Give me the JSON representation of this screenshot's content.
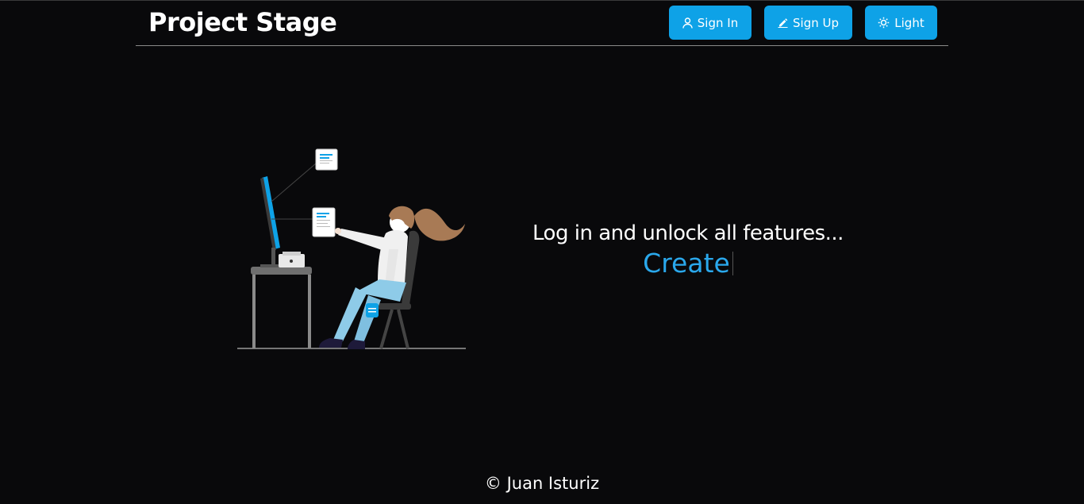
{
  "header": {
    "brand": "Project Stage",
    "buttons": {
      "sign_in": "Sign In",
      "sign_up": "Sign Up",
      "theme": "Light"
    }
  },
  "main": {
    "headline": "Log in and unlock all features...",
    "link": "Create"
  },
  "footer": {
    "copyright": "© Juan Isturiz"
  },
  "icons": {
    "sign_in": "user-icon",
    "sign_up": "pencil-icon",
    "theme": "sun-icon"
  },
  "colors": {
    "background": "#09090b",
    "accent": "#0ea2e7",
    "link": "#2aa8ec"
  }
}
